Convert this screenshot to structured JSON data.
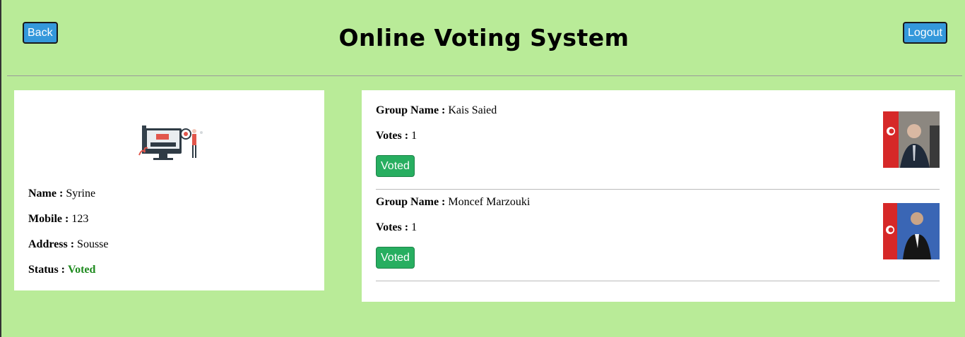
{
  "header": {
    "back_label": "Back",
    "title": "Online Voting System",
    "logout_label": "Logout"
  },
  "profile": {
    "image_icon": "voting-illustration-icon",
    "name_label": "Name :",
    "name_value": "Syrine",
    "mobile_label": "Mobile :",
    "mobile_value": "123",
    "address_label": "Address :",
    "address_value": "Sousse",
    "status_label": "Status :",
    "status_value": "Voted"
  },
  "groups": [
    {
      "group_name_label": "Group Name :",
      "group_name": "Kais Saied",
      "votes_label": "Votes :",
      "votes": "1",
      "button_label": "Voted",
      "photo_icon": "candidate-photo-icon"
    },
    {
      "group_name_label": "Group Name :",
      "group_name": "Moncef Marzouki",
      "votes_label": "Votes :",
      "votes": "1",
      "button_label": "Voted",
      "photo_icon": "candidate-photo-icon"
    }
  ],
  "colors": {
    "background": "#b9eb98",
    "primary_button": "#3498db",
    "voted_button": "#27ae60",
    "status_voted": "#1e8a1e"
  }
}
